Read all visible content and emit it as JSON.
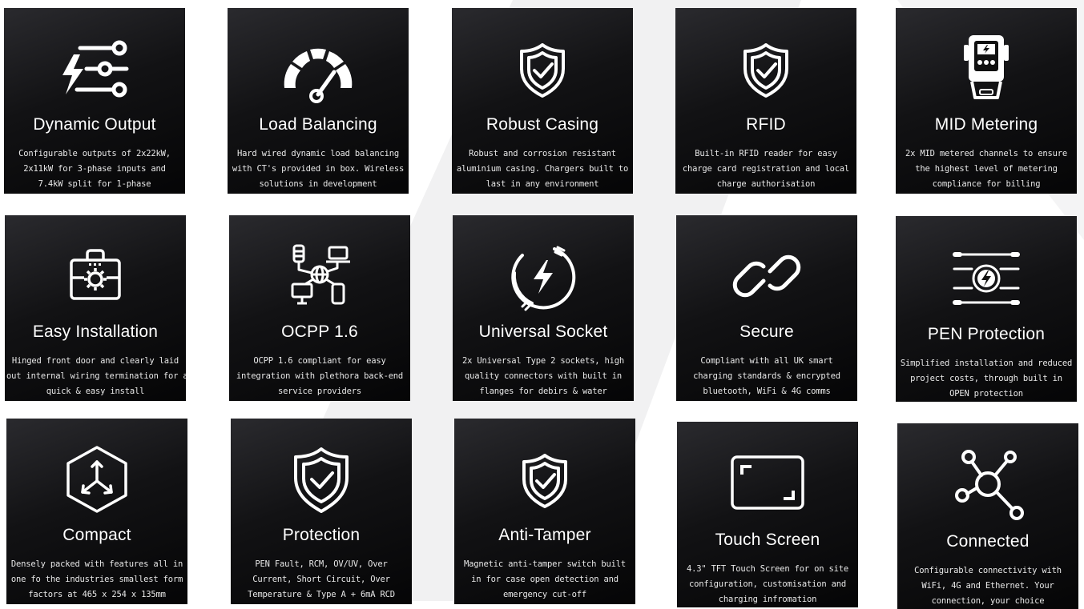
{
  "features": [
    {
      "title": "Dynamic Output",
      "icon": "sliders-bolt-icon",
      "lines": [
        "Configurable outputs of 2x22kW,",
        "2x11kW for 3-phase inputs and",
        "7.4kW split for 1-phase"
      ]
    },
    {
      "title": "Load Balancing",
      "icon": "speedometer-icon",
      "lines": [
        "Hard wired dynamic load balancing",
        "with CT's provided in box. Wireless",
        "solutions in development"
      ]
    },
    {
      "title": "Robust Casing",
      "icon": "shield-check-icon",
      "lines": [
        "Robust and corrosion resistant",
        "aluminium casing. Chargers built to",
        "last in any environment"
      ]
    },
    {
      "title": "RFID",
      "icon": "shield-check-icon",
      "lines": [
        "Built-in RFID reader for easy",
        "charge card registration and local",
        "charge authorisation"
      ]
    },
    {
      "title": "MID Metering",
      "icon": "meter-icon",
      "lines": [
        "2x MID metered channels to ensure",
        "the highest level of metering",
        "compliance for billing"
      ]
    },
    {
      "title": "Easy Installation",
      "icon": "toolbox-gear-icon",
      "lines": [
        "Hinged front door and clearly laid",
        "out internal wiring termination for a",
        "quick & easy install"
      ]
    },
    {
      "title": "OCPP 1.6",
      "icon": "network-devices-icon",
      "lines": [
        "OCPP 1.6 compliant for easy",
        "integration with plethora back-end",
        "service providers"
      ]
    },
    {
      "title": "Universal Socket",
      "icon": "plug-bolt-icon",
      "lines": [
        "2x Universal Type 2 sockets, high",
        "quality connectors with built in",
        "flanges for debirs & water"
      ]
    },
    {
      "title": "Secure",
      "icon": "chain-link-icon",
      "lines": [
        "Compliant with all UK smart",
        "charging standards & encrypted",
        "bluetooth, WiFi & 4G comms"
      ]
    },
    {
      "title": "PEN Protection",
      "icon": "bolt-circuit-icon",
      "lines": [
        "Simplified installation and reduced",
        "project costs, through built in",
        "OPEN protection"
      ]
    },
    {
      "title": "Compact",
      "icon": "hexagon-arrows-icon",
      "lines": [
        "Densely packed with features all in",
        "one fo the industries smallest form",
        "factors at 465 x 254 x 135mm"
      ]
    },
    {
      "title": "Protection",
      "icon": "shield-check-icon",
      "lines": [
        "PEN Fault, RCM, OV/UV, Over",
        "Current, Short Circuit, Over",
        "Temperature & Type A + 6mA  RCD"
      ]
    },
    {
      "title": "Anti-Tamper",
      "icon": "shield-check-icon",
      "lines": [
        "Magnetic anti-tamper switch built",
        "in for case open detection and",
        "emergency cut-off"
      ]
    },
    {
      "title": "Touch Screen",
      "icon": "touch-screen-icon",
      "lines": [
        "4.3\" TFT Touch Screen for on site",
        "configuration, customisation and",
        "charging infromation"
      ]
    },
    {
      "title": "Connected",
      "icon": "hub-nodes-icon",
      "lines": [
        "Configurable connectivity with",
        "WiFi, 4G and Ethernet. Your",
        "connection, your choice"
      ]
    }
  ]
}
